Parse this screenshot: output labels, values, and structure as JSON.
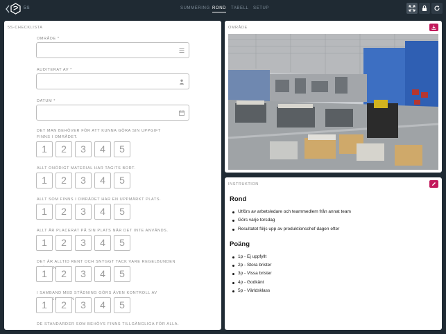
{
  "app": {
    "title": "5S"
  },
  "nav": {
    "tabs": [
      "SUMMERING",
      "ROND",
      "TABELL",
      "SETUP"
    ],
    "active": "ROND"
  },
  "checklist": {
    "title": "5S-CHECKLISTA",
    "fields": [
      {
        "label": "OMRÅDE *",
        "icon": "list-icon"
      },
      {
        "label": "AUDITERAT AV *",
        "icon": "user-icon"
      },
      {
        "label": "DATUM *",
        "icon": "calendar-icon"
      }
    ],
    "questions": [
      {
        "text": "DET MAN BEHÖVER FÖR ATT KUNNA GÖRA SIN UPPGIFT FINNS I OMRÅDET.",
        "options": [
          "1",
          "2",
          "3",
          "4",
          "5"
        ]
      },
      {
        "text": "ALLT ONÖDIGT MATERIAL HAR TAGITS BORT.",
        "options": [
          "1",
          "2",
          "3",
          "4",
          "5"
        ]
      },
      {
        "text": "ALLT SOM FINNS I OMRÅDET HAR EN UPPMÄRKT PLATS.",
        "options": [
          "1",
          "2",
          "3",
          "4",
          "5"
        ]
      },
      {
        "text": "ALLT ÄR PLACERAT PÅ SIN PLATS NÄR DET INTE ANVÄNDS.",
        "options": [
          "1",
          "2",
          "3",
          "4",
          "5"
        ]
      },
      {
        "text": "DET ÄR ALLTID RENT OCH SNYGGT TACK VARE REGELBUNDEN STÄDNING.",
        "options": [
          "1",
          "2",
          "3",
          "4",
          "5"
        ]
      },
      {
        "text": "I SAMBAND MED STÄDNING GÖRS ÄVEN KONTROLL AV ARBETSPLATSEN.",
        "options": [
          "1",
          "2",
          "3",
          "4",
          "5"
        ]
      },
      {
        "text": "DE STANDARDER SOM BEHÖVS FINNS TILLGÄNGLIGA FÖR ALLA."
      }
    ]
  },
  "area": {
    "title": "OMRÅDE"
  },
  "instruction": {
    "title": "INSTRUKTION",
    "sections": [
      {
        "heading": "Rond",
        "items": [
          "Utförs av arbetsledare och teammedlem från annat team",
          "Görs varje torsdag",
          "Resultatet följs upp av produktionschef dagen efter"
        ]
      },
      {
        "heading": "Poäng",
        "items": [
          "1p - Ej uppfyllt",
          "2p - Stora brister",
          "3p - Vissa brister",
          "4p - Godkänt",
          "5p - Världsklass"
        ]
      }
    ]
  },
  "colors": {
    "topbar": "#1f2a33",
    "accent": "#c2185b",
    "card": "#ffffff"
  }
}
